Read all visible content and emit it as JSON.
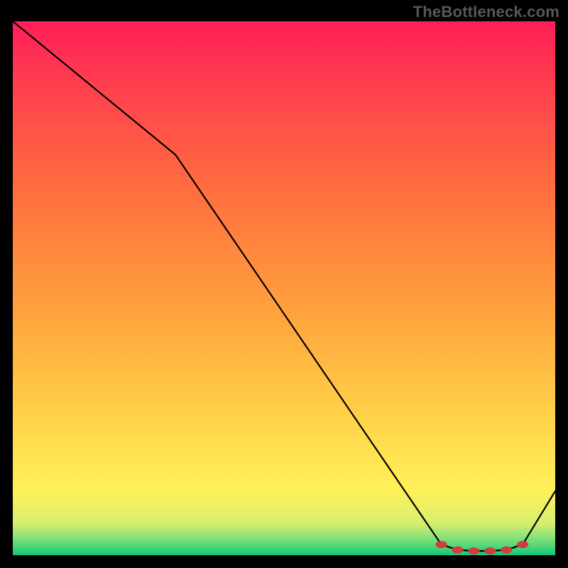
{
  "attribution": "TheBottleneck.com",
  "chart_data": {
    "type": "line",
    "title": "",
    "xlabel": "",
    "ylabel": "",
    "xlim": [
      0,
      100
    ],
    "ylim": [
      0,
      100
    ],
    "x": [
      0,
      30,
      79,
      82,
      85,
      88,
      91,
      94,
      100
    ],
    "values": [
      100,
      75,
      2,
      1,
      0.8,
      0.8,
      1,
      2,
      12
    ],
    "markers_x": [
      79,
      82,
      85,
      88,
      91,
      94
    ],
    "markers_y": [
      2,
      1,
      0.8,
      0.8,
      1,
      2
    ],
    "gradient_stops": [
      {
        "offset": 0,
        "color": "#12c77a"
      },
      {
        "offset": 3,
        "color": "#7ee07a"
      },
      {
        "offset": 6,
        "color": "#d8ee6e"
      },
      {
        "offset": 12,
        "color": "#fff15a"
      },
      {
        "offset": 25,
        "color": "#ffd449"
      },
      {
        "offset": 45,
        "color": "#ffa33d"
      },
      {
        "offset": 70,
        "color": "#ff6a3f"
      },
      {
        "offset": 90,
        "color": "#ff3a50"
      },
      {
        "offset": 100,
        "color": "#ff1e58"
      }
    ]
  }
}
